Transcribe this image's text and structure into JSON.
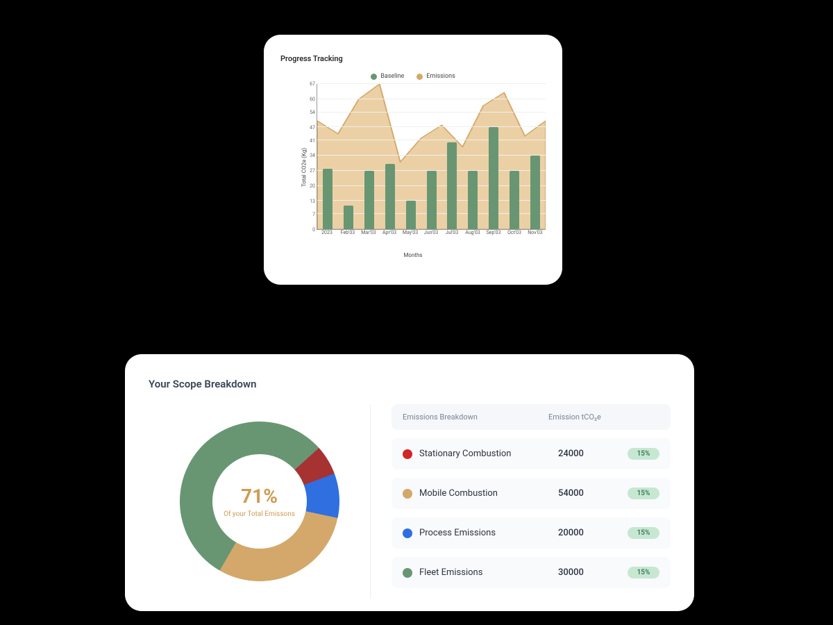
{
  "progress": {
    "title": "Progress Tracking",
    "legend": {
      "baseline": "Baseline",
      "emissions": "Emissions"
    },
    "ylabel": "Total CO2e (Kg)",
    "xlabel": "Months"
  },
  "breakdown": {
    "title": "Your Scope Breakdown",
    "donut_pct": "71%",
    "donut_sub": "Of your Total Emissons",
    "table_head": {
      "name": "Emissions Breakdown",
      "value": "Emission tCO₂e"
    },
    "rows": [
      {
        "label": "Stationary Combustion",
        "value": "24000",
        "pct": "15%"
      },
      {
        "label": "Mobile Combustion",
        "value": "54000",
        "pct": "15%"
      },
      {
        "label": "Process Emissions",
        "value": "20000",
        "pct": "15%"
      },
      {
        "label": "Fleet Emissions",
        "value": "30000",
        "pct": "15%"
      }
    ]
  },
  "colors": {
    "green": "#689673",
    "tan": "#d3a86a",
    "tanFill": "#ecd0a5",
    "red": "#a73232",
    "blue": "#2f6fe0",
    "pill_bg": "#c7e7d3",
    "pill_fg": "#2f7a4d"
  },
  "chart_data": [
    {
      "type": "bar+area",
      "title": "Progress Tracking",
      "xlabel": "Months",
      "ylabel": "Total CO2e (Kg)",
      "ylim": [
        0,
        67
      ],
      "yticks": [
        0,
        7,
        13,
        20,
        27,
        34,
        41,
        47,
        54,
        60,
        67
      ],
      "categories": [
        "2023",
        "Feb'03",
        "Mar'03",
        "Apr'03",
        "May'03",
        "Jun'03",
        "Jul'03",
        "Aug'03",
        "Sep'03",
        "Oct'03",
        "Nov'03"
      ],
      "series": [
        {
          "name": "Baseline",
          "kind": "bar",
          "color": "#689673",
          "values": [
            28,
            11,
            27,
            30,
            13,
            27,
            40,
            27,
            47,
            27,
            34
          ]
        },
        {
          "name": "Emissions",
          "kind": "area",
          "color": "#d3a86a",
          "values": [
            50,
            44,
            60,
            67,
            31,
            42,
            48,
            38,
            57,
            63,
            43,
            50
          ]
        }
      ]
    },
    {
      "type": "pie",
      "title": "Your Scope Breakdown",
      "center_label": "71%",
      "center_sub": "Of your Total Emissons",
      "series": [
        {
          "name": "Fleet Emissions",
          "value": 30000,
          "pct": 55,
          "color": "#689673"
        },
        {
          "name": "Stationary Combustion",
          "value": 24000,
          "pct": 6,
          "color": "#a73232"
        },
        {
          "name": "Process Emissions",
          "value": 20000,
          "pct": 9,
          "color": "#2f6fe0"
        },
        {
          "name": "Mobile Combustion",
          "value": 54000,
          "pct": 30,
          "color": "#d3a86a"
        }
      ]
    }
  ]
}
